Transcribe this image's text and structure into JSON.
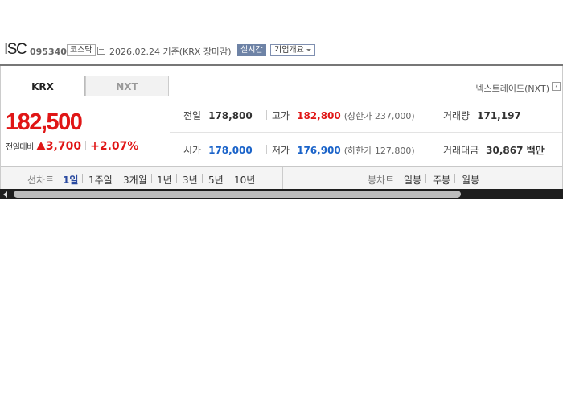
{
  "header": {
    "stock_name": "ISC",
    "stock_code": "095340",
    "market": "코스닥",
    "date_text": "2026.02.24 기준(KRX 장마감)",
    "realtime_label": "실시간",
    "company_info_label": "기업개요"
  },
  "tabs": {
    "krx": "KRX",
    "nxt": "NXT"
  },
  "nxt_link": "넥스트레이드(NXT)",
  "help": "?",
  "quote": {
    "price": "182,500",
    "change_label": "전일대비",
    "change_amount": "3,700",
    "change_percent": "+2.07%",
    "direction": "up"
  },
  "stats": {
    "prev_close": {
      "label": "전일",
      "value": "178,800"
    },
    "high": {
      "label": "고가",
      "value": "182,800",
      "sub": "(상한가 237,000)"
    },
    "volume": {
      "label": "거래량",
      "value": "171,197"
    },
    "open": {
      "label": "시가",
      "value": "178,000"
    },
    "low": {
      "label": "저가",
      "value": "176,900",
      "sub": "(하한가 127,800)"
    },
    "amount": {
      "label": "거래대금",
      "value": "30,867 백만"
    }
  },
  "chart_bar": {
    "line_label": "선차트",
    "line_periods": [
      "1일",
      "1주일",
      "3개월",
      "1년",
      "3년",
      "5년",
      "10년"
    ],
    "selected": "1일",
    "candle_label": "봉차트",
    "candle_periods": [
      "일봉",
      "주봉",
      "월봉"
    ]
  },
  "colors": {
    "up": "#e01616",
    "down": "#1a63c9",
    "selected": "#2a4aa0"
  }
}
